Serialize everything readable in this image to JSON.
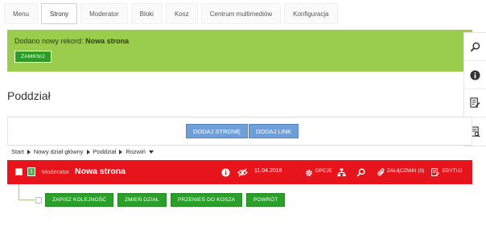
{
  "tabs": [
    {
      "label": "Menu",
      "active": false
    },
    {
      "label": "Strony",
      "active": true
    },
    {
      "label": "Moderator",
      "active": false
    },
    {
      "label": "Bloki",
      "active": false
    },
    {
      "label": "Kosz",
      "active": false
    },
    {
      "label": "Centrum multimediów",
      "active": false
    },
    {
      "label": "Konfiguracja",
      "active": false
    }
  ],
  "alert": {
    "message_prefix": "Dodano nowy rekord:",
    "message_record": "Nowa strona",
    "close_label": "ZAMKNIJ",
    "color": "#9acd4c"
  },
  "side_tools": [
    "search-icon",
    "info-icon",
    "edit-document-icon",
    "preview-document-icon"
  ],
  "section": {
    "title": "Poddział"
  },
  "add_bar": {
    "add_page_label": "DODAJ STRONĘ",
    "add_link_label": "DODAJ LINK"
  },
  "breadcrumb": {
    "items": [
      "Start",
      "Nowy dział główny",
      "Poddział"
    ],
    "expand_label": "Rozwiń"
  },
  "record_row": {
    "number": "1",
    "author": "Moderator",
    "title": "Nowa strona",
    "date": "11.04.2016",
    "options_label": "OPCJE",
    "attachments_label": "ZAŁĄCZNIKI (0)",
    "edit_label": "EDYTUJ",
    "color": "#e8141b"
  },
  "child_actions": {
    "save_order_label": "ZAPISZ KOLEJNOŚĆ",
    "change_section_label": "ZMIEŃ DZIAŁ",
    "move_to_trash_label": "PRZENIEŚ DO KOSZA",
    "back_label": "POWRÓT"
  }
}
